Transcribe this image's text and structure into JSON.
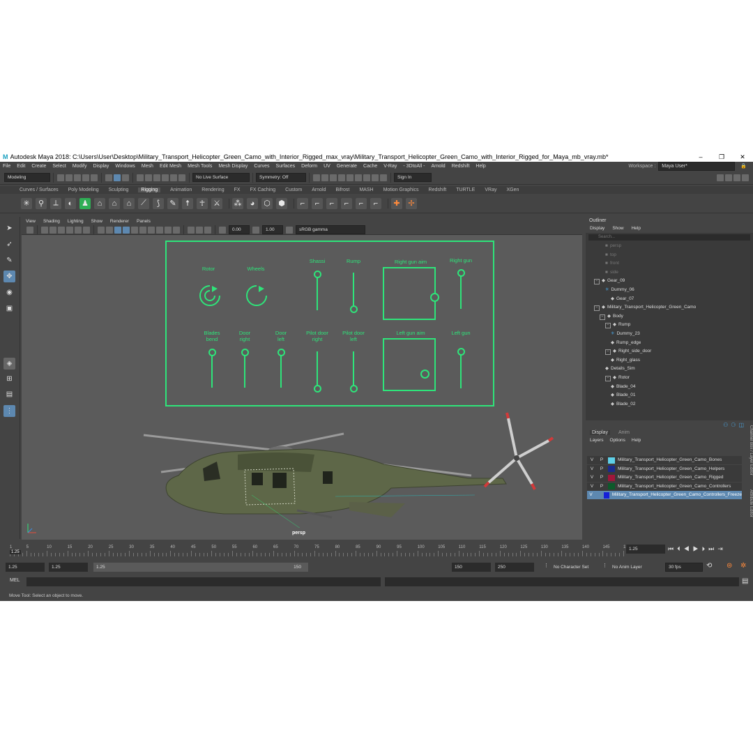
{
  "window": {
    "title": "Autodesk Maya 2018: C:\\Users\\User\\Desktop\\Military_Transport_Helicopter_Green_Camo_with_Interior_Rigged_max_vray\\Military_Transport_Helicopter_Green_Camo_with_Interior_Rigged_for_Maya_mb_vray.mb*"
  },
  "menubar": [
    "File",
    "Edit",
    "Create",
    "Select",
    "Modify",
    "Display",
    "Windows",
    "Mesh",
    "Edit Mesh",
    "Mesh Tools",
    "Mesh Display",
    "Curves",
    "Surfaces",
    "Deform",
    "UV",
    "Generate",
    "Cache",
    "V-Ray",
    "- 3DtoAll -",
    "Arnold",
    "Redshift",
    "Help"
  ],
  "workspace": {
    "label": "Workspace :",
    "value": "Maya User*"
  },
  "statusline": {
    "mode": "Modeling",
    "live_surface": "No Live Surface",
    "symmetry": "Symmetry: Off",
    "signin": "Sign In"
  },
  "shelf_tabs": [
    "Curves / Surfaces",
    "Poly Modeling",
    "Sculpting",
    "Rigging",
    "Animation",
    "Rendering",
    "FX",
    "FX Caching",
    "Custom",
    "Arnold",
    "Bifrost",
    "MASH",
    "Motion Graphics",
    "Redshift",
    "TURTLE",
    "VRay",
    "XGen"
  ],
  "shelf_active_tab": "Rigging",
  "panel_menu": [
    "View",
    "Shading",
    "Lighting",
    "Show",
    "Renderer",
    "Panels"
  ],
  "panel_toolbar": {
    "exposure": "0.00",
    "gamma": "1.00",
    "colorspace": "sRGB gamma"
  },
  "viewport": {
    "camera": "persp"
  },
  "rig_panel": {
    "labels": {
      "rotor": "Rotor",
      "wheels": "Wheels",
      "shassi": "Shassi",
      "rump": "Rump",
      "right_gun_aim": "Right gun aim",
      "right_gun": "Right gun",
      "blades_bend": "Blades\nbend",
      "door_right": "Door\nright",
      "door_left": "Door\nleft",
      "pilot_door_right": "Pilot door\nright",
      "pilot_door_left": "Pilot door\nleft",
      "left_gun_aim": "Left gun aim",
      "left_gun": "Left gun"
    }
  },
  "outliner": {
    "title": "Outliner",
    "menu": [
      "Display",
      "Show",
      "Help"
    ],
    "search_placeholder": "Search...",
    "items": [
      "persp",
      "top",
      "front",
      "side",
      "Gear_09",
      "Dummy_06",
      "Gear_07",
      "Military_Transport_Helicopter_Green_Camo",
      "Body",
      "Rump",
      "Dummy_23",
      "Rump_edge",
      "Right_side_door",
      "Right_glass",
      "Details_Sim",
      "Rotor",
      "Blade_04",
      "Blade_01",
      "Blade_02"
    ]
  },
  "layer_editor": {
    "tabs": [
      "Display",
      "Anim"
    ],
    "menu": [
      "Layers",
      "Options",
      "Help"
    ],
    "layers": [
      {
        "v": "V",
        "p": "P",
        "name": "Military_Transport_Helicopter_Green_Camo_Bones",
        "color": "#5fd0e8"
      },
      {
        "v": "V",
        "p": "P",
        "name": "Military_Transport_Helicopter_Green_Camo_Helpers",
        "color": "#1a2a8c"
      },
      {
        "v": "V",
        "p": "P",
        "name": "Military_Transport_Helicopter_Green_Camo_Rigged",
        "color": "#a0163a"
      },
      {
        "v": "V",
        "p": "P",
        "name": "Military_Transport_Helicopter_Green_Camo_Controllers",
        "color": "#0c5a2a"
      },
      {
        "v": "V",
        "p": "",
        "name": "Military_Transport_Helicopter_Green_Camo_Controllers_Freeze",
        "color": "#1520d8"
      }
    ],
    "side_tabs": [
      "Channel Box / Layer Editor",
      "Attribute Editor"
    ]
  },
  "timeline": {
    "ticks": [
      "1",
      "5",
      "10",
      "15",
      "20",
      "25",
      "30",
      "35",
      "40",
      "45",
      "50",
      "55",
      "60",
      "65",
      "70",
      "75",
      "80",
      "85",
      "90",
      "95",
      "100",
      "105",
      "110",
      "115",
      "120",
      "125",
      "130",
      "135",
      "140",
      "145",
      "150"
    ],
    "current_frame": "1.25",
    "current_field": "1.25"
  },
  "range": {
    "start": "1.25",
    "anim_start": "1.25",
    "range_start": "1.25",
    "range_end": "150",
    "end": "150",
    "anim_end": "250",
    "character_set": "No Character Set",
    "anim_layer": "No Anim Layer",
    "fps": "30 fps"
  },
  "command": {
    "label": "MEL"
  },
  "help_line": "Move Tool: Select an object to move."
}
